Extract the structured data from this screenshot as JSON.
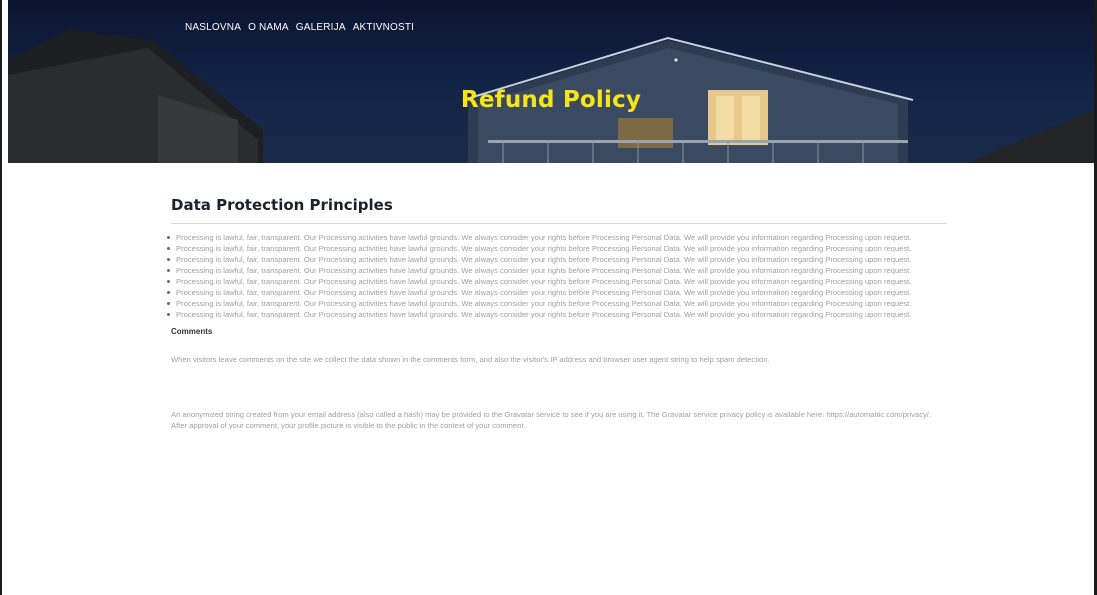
{
  "nav": {
    "items": [
      {
        "label": "NASLOVNA"
      },
      {
        "label": "O NAMA"
      },
      {
        "label": "GALERIJA"
      },
      {
        "label": "AKTIVNOSTI"
      }
    ]
  },
  "hero": {
    "title": "Refund Policy"
  },
  "content": {
    "section_title": "Data Protection Principles",
    "principles": [
      {
        "text": "Processing is lawful, fair, transparent. Our Processing activities have lawful grounds. We always consider your rights before Processing Personal Data. We will provide you information regarding Processing upon request."
      },
      {
        "text": "Processing is lawful, fair, transparent. Our Processing activities have lawful grounds. We always consider your rights before Processing Personal Data. We will provide you information regarding Processing upon request."
      },
      {
        "text": "Processing is lawful, fair, transparent. Our Processing activities have lawful grounds. We always consider your rights before Processing Personal Data. We will provide you information regarding Processing upon request."
      },
      {
        "text": "Processing is lawful, fair, transparent. Our Processing activities have lawful grounds. We always consider your rights before Processing Personal Data. We will provide you information regarding Processing upon request."
      },
      {
        "text": "Processing is lawful, fair, transparent. Our Processing activities have lawful grounds. We always consider your rights before Processing Personal Data. We will provide you information regarding Processing upon request."
      },
      {
        "text": "Processing is lawful, fair, transparent. Our Processing activities have lawful grounds. We always consider your rights before Processing Personal Data. We will provide you information regarding Processing upon request."
      },
      {
        "text": "Processing is lawful, fair, transparent. Our Processing activities have lawful grounds. We always consider your rights before Processing Personal Data. We will provide you information regarding Processing upon request."
      },
      {
        "text": "Processing is lawful, fair, transparent. Our Processing activities have lawful grounds. We always consider your rights before Processing Personal Data. We will provide you information regarding Processing upon request."
      }
    ],
    "comments_heading": "Comments",
    "comments_para1": "When visitors leave comments on the site we collect the data shown in the comments form, and also the visitor's IP address and browser user agent string to help spam detection.",
    "comments_para2": "An anonymized string created from your email address (also called a hash) may be provided to the Gravatar service to see if you are using it. The Gravatar service privacy policy is available here: https://automattic.com/privacy/. After approval of your comment, your profile picture is visible to the public in the context of your comment."
  },
  "colors": {
    "title_yellow": "#f7e51a",
    "heading_dark": "#1d1f2e",
    "body_gray": "#a0a0a0"
  }
}
